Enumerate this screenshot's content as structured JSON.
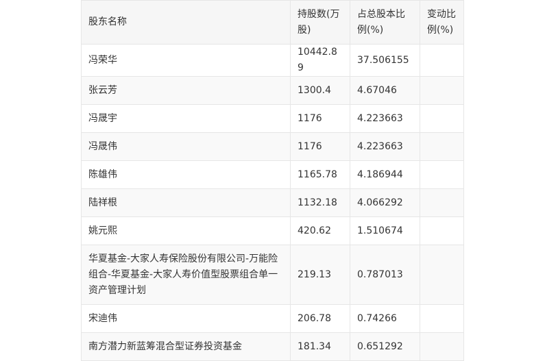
{
  "table": {
    "headers": [
      "股东名称",
      "持股数(万股)",
      "占总股本比例(%)",
      "变动比例(%)"
    ],
    "rows": [
      {
        "name": "冯荣华",
        "shares": "10442.89",
        "ratio": "37.506155",
        "change": ""
      },
      {
        "name": "张云芳",
        "shares": "1300.4",
        "ratio": "4.67046",
        "change": ""
      },
      {
        "name": "冯晟宇",
        "shares": "1176",
        "ratio": "4.223663",
        "change": ""
      },
      {
        "name": "冯晟伟",
        "shares": "1176",
        "ratio": "4.223663",
        "change": ""
      },
      {
        "name": "陈雄伟",
        "shares": "1165.78",
        "ratio": "4.186944",
        "change": ""
      },
      {
        "name": "陆祥根",
        "shares": "1132.18",
        "ratio": "4.066292",
        "change": ""
      },
      {
        "name": "姚元熙",
        "shares": "420.62",
        "ratio": "1.510674",
        "change": ""
      },
      {
        "name": "华夏基金-大家人寿保险股份有限公司-万能险组合-华夏基金-大家人寿价值型股票组合单一资产管理计划",
        "shares": "219.13",
        "ratio": "0.787013",
        "change": ""
      },
      {
        "name": "宋迪伟",
        "shares": "206.78",
        "ratio": "0.74266",
        "change": ""
      },
      {
        "name": "南方潜力新蓝筹混合型证券投资基金",
        "shares": "181.34",
        "ratio": "0.651292",
        "change": ""
      }
    ]
  }
}
